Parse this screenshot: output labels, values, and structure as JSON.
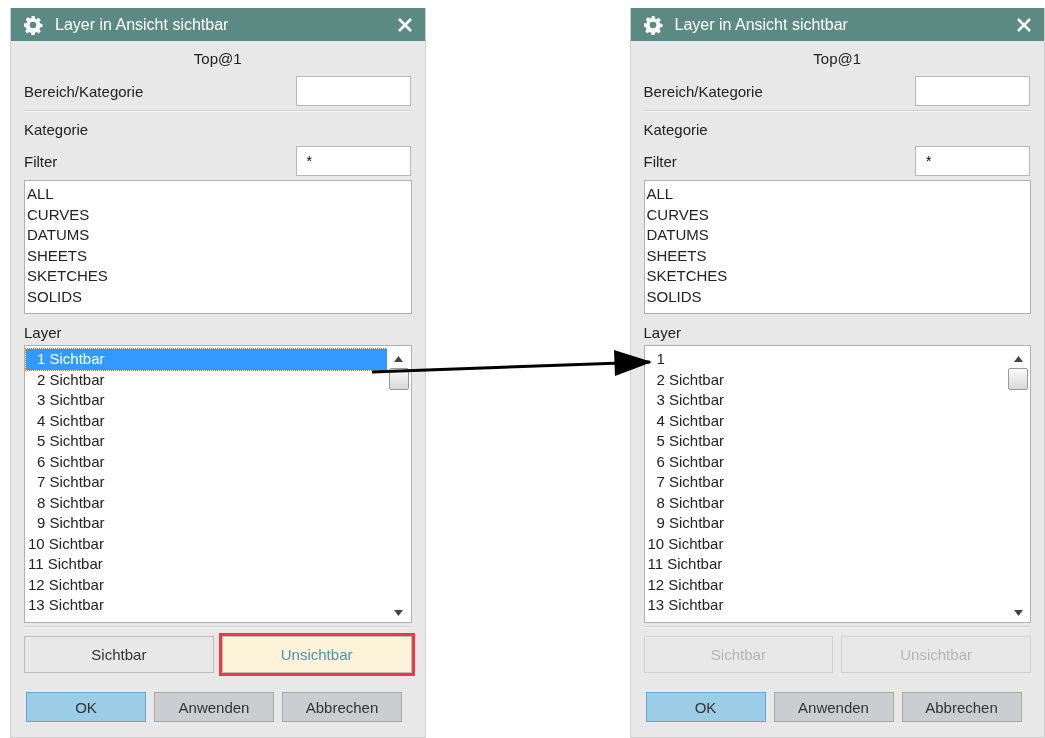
{
  "dialogs": [
    {
      "title": "Layer in Ansicht sichtbar",
      "view_name": "Top@1",
      "range_label": "Bereich/Kategorie",
      "category_label": "Kategorie",
      "filter_label": "Filter",
      "filter_value": "*",
      "categories": [
        "ALL",
        "CURVES",
        "DATUMS",
        "SHEETS",
        "SKETCHES",
        "SOLIDS"
      ],
      "layer_label": "Layer",
      "layers": [
        {
          "label": "1 Sichtbar",
          "selected": true
        },
        {
          "label": "2 Sichtbar",
          "selected": false
        },
        {
          "label": "3 Sichtbar",
          "selected": false
        },
        {
          "label": "4 Sichtbar",
          "selected": false
        },
        {
          "label": "5 Sichtbar",
          "selected": false
        },
        {
          "label": "6 Sichtbar",
          "selected": false
        },
        {
          "label": "7 Sichtbar",
          "selected": false
        },
        {
          "label": "8 Sichtbar",
          "selected": false
        },
        {
          "label": "9 Sichtbar",
          "selected": false
        },
        {
          "label": "10 Sichtbar",
          "selected": false
        },
        {
          "label": "11 Sichtbar",
          "selected": false
        },
        {
          "label": "12 Sichtbar",
          "selected": false
        },
        {
          "label": "13 Sichtbar",
          "selected": false
        }
      ],
      "action_buttons": [
        {
          "label": "Sichtbar",
          "disabled": false,
          "highlighted": false
        },
        {
          "label": "Unsichtbar",
          "disabled": false,
          "highlighted": true
        }
      ],
      "buttons": [
        {
          "label": "OK",
          "kind": "default"
        },
        {
          "label": "Anwenden",
          "kind": "normal"
        },
        {
          "label": "Abbrechen",
          "kind": "normal"
        }
      ]
    },
    {
      "title": "Layer in Ansicht sichtbar",
      "view_name": "Top@1",
      "range_label": "Bereich/Kategorie",
      "category_label": "Kategorie",
      "filter_label": "Filter",
      "filter_value": "*",
      "categories": [
        "ALL",
        "CURVES",
        "DATUMS",
        "SHEETS",
        "SKETCHES",
        "SOLIDS"
      ],
      "layer_label": "Layer",
      "layers": [
        {
          "label": "1",
          "selected": false
        },
        {
          "label": "2 Sichtbar",
          "selected": false
        },
        {
          "label": "3 Sichtbar",
          "selected": false
        },
        {
          "label": "4 Sichtbar",
          "selected": false
        },
        {
          "label": "5 Sichtbar",
          "selected": false
        },
        {
          "label": "6 Sichtbar",
          "selected": false
        },
        {
          "label": "7 Sichtbar",
          "selected": false
        },
        {
          "label": "8 Sichtbar",
          "selected": false
        },
        {
          "label": "9 Sichtbar",
          "selected": false
        },
        {
          "label": "10 Sichtbar",
          "selected": false
        },
        {
          "label": "11 Sichtbar",
          "selected": false
        },
        {
          "label": "12 Sichtbar",
          "selected": false
        },
        {
          "label": "13 Sichtbar",
          "selected": false
        }
      ],
      "action_buttons": [
        {
          "label": "Sichtbar",
          "disabled": true,
          "highlighted": false
        },
        {
          "label": "Unsichtbar",
          "disabled": true,
          "highlighted": false
        }
      ],
      "buttons": [
        {
          "label": "OK",
          "kind": "default"
        },
        {
          "label": "Anwenden",
          "kind": "normal"
        },
        {
          "label": "Abbrechen",
          "kind": "normal"
        }
      ]
    }
  ]
}
